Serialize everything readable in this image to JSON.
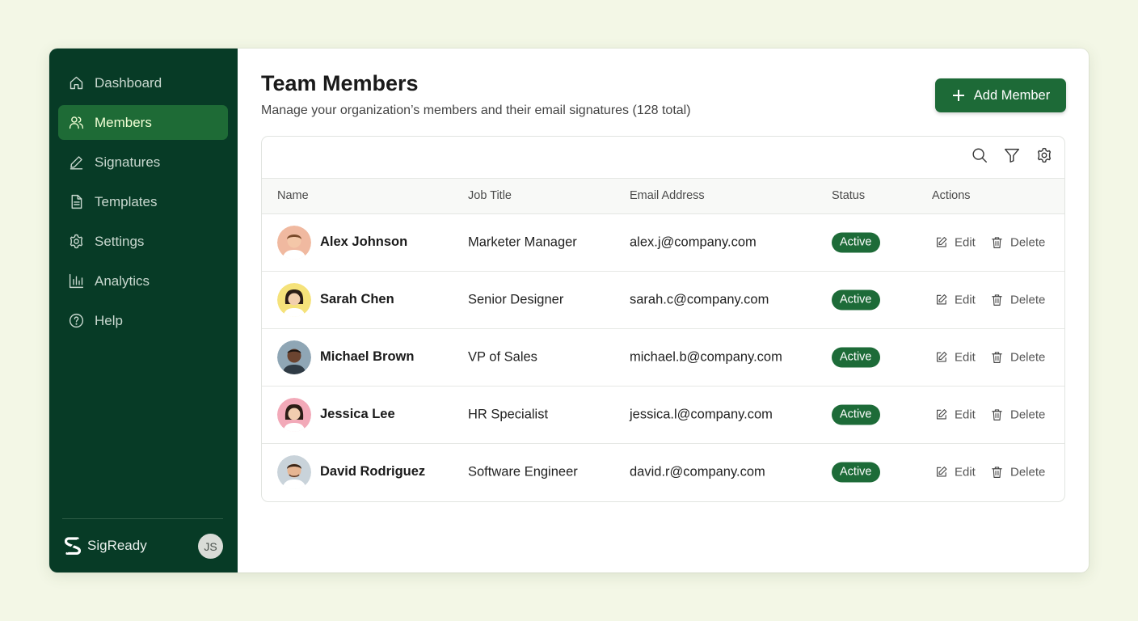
{
  "sidebar": {
    "items": [
      {
        "label": "Dashboard",
        "icon": "home-icon"
      },
      {
        "label": "Members",
        "icon": "users-icon",
        "active": true
      },
      {
        "label": "Signatures",
        "icon": "pen-icon"
      },
      {
        "label": "Templates",
        "icon": "document-icon"
      },
      {
        "label": "Settings",
        "icon": "gear-icon"
      },
      {
        "label": "Analytics",
        "icon": "bar-chart-icon"
      },
      {
        "label": "Help",
        "icon": "help-circle-icon"
      }
    ],
    "brand": "SigReady",
    "user_initials": "JS"
  },
  "header": {
    "title": "Team Members",
    "subtitle": "Manage your organization’s members and their email signatures (128 total)",
    "add_button_label": "Add Member"
  },
  "table": {
    "columns": [
      "Name",
      "Job Title",
      "Email Address",
      "Status",
      "Actions"
    ],
    "rows": [
      {
        "name": "Alex Johnson",
        "title": "Marketer Manager",
        "email": "alex.j@company.com",
        "status": "Active"
      },
      {
        "name": "Sarah Chen",
        "title": "Senior Designer",
        "email": "sarah.c@company.com",
        "status": "Active"
      },
      {
        "name": "Michael Brown",
        "title": "VP of Sales",
        "email": "michael.b@company.com",
        "status": "Active"
      },
      {
        "name": "Jessica Lee",
        "title": "HR Specialist",
        "email": "jessica.l@company.com",
        "status": "Active"
      },
      {
        "name": "David Rodriguez",
        "title": "Software Engineer",
        "email": "david.r@company.com",
        "status": "Active"
      }
    ],
    "actions": {
      "edit": "Edit",
      "delete": "Delete"
    }
  },
  "colors": {
    "sidebar_bg": "#073b26",
    "accent": "#1d6a37",
    "page_bg": "#f3f7e6"
  }
}
